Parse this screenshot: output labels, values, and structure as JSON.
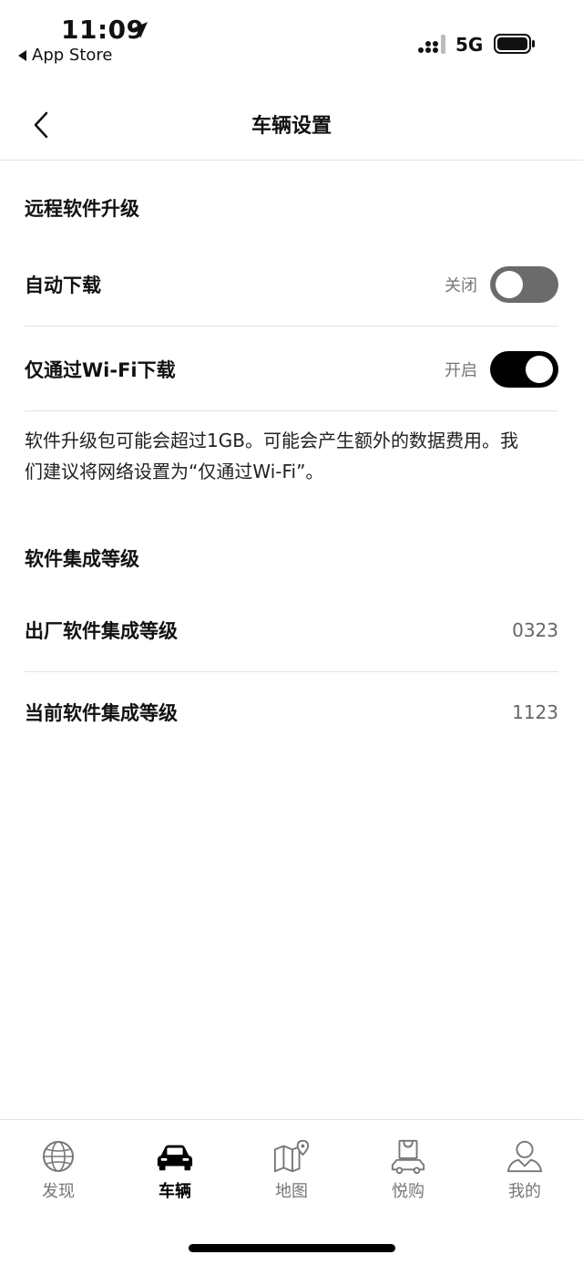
{
  "status": {
    "time": "11:09",
    "back_app": "App Store",
    "network": "5G"
  },
  "header": {
    "title": "车辆设置"
  },
  "remote_update": {
    "section_title": "远程软件升级",
    "auto_download": {
      "label": "自动下载",
      "state_text": "关闭",
      "enabled": false
    },
    "wifi_only": {
      "label": "仅通过Wi-Fi下载",
      "state_text": "开启",
      "enabled": true
    },
    "description": "软件升级包可能会超过1GB。可能会产生额外的数据费用。我们建议将网络设置为“仅通过Wi-Fi”。"
  },
  "integration": {
    "section_title": "软件集成等级",
    "factory": {
      "label": "出厂软件集成等级",
      "value": "0323"
    },
    "current": {
      "label": "当前软件集成等级",
      "value": "1123"
    }
  },
  "tabs": [
    {
      "label": "发现",
      "icon": "globe-icon",
      "active": false
    },
    {
      "label": "车辆",
      "icon": "car-icon",
      "active": true
    },
    {
      "label": "地图",
      "icon": "map-icon",
      "active": false
    },
    {
      "label": "悦购",
      "icon": "shopping-car-icon",
      "active": false
    },
    {
      "label": "我的",
      "icon": "person-icon",
      "active": false
    }
  ]
}
